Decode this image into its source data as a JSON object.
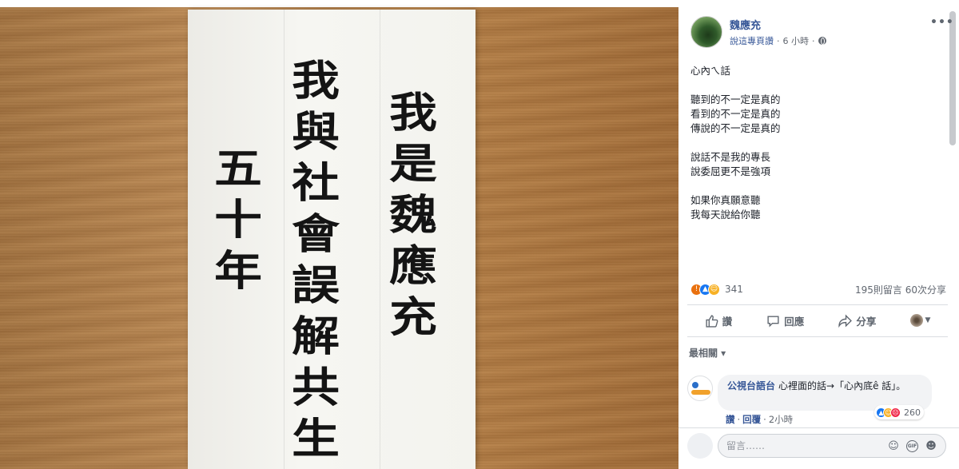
{
  "photo": {
    "calligraphy": {
      "right_column": [
        "我",
        "是",
        "魏",
        "應",
        "充"
      ],
      "middle_column": [
        "我",
        "與",
        "社",
        "會",
        "誤",
        "解",
        "共",
        "生"
      ],
      "left_column": [
        "五",
        "十",
        "年"
      ]
    }
  },
  "post": {
    "author": "魏應充",
    "page_name": "說這專頁讚",
    "time": "6 小時",
    "dot_sep": "·",
    "more_label": "•••",
    "body": [
      [
        "心內ㄟ話"
      ],
      [
        "聽到的不一定是真的",
        "看到的不一定是真的",
        "傳說的不一定是真的"
      ],
      [
        "說話不是我的專長",
        "說委屈更不是強項"
      ],
      [
        "如果你真願意聽",
        "我每天說給你聽"
      ]
    ],
    "reaction_count": "341",
    "comment_share": "195則留言 60次分享"
  },
  "actions": {
    "like": "讚",
    "comment": "回應",
    "share": "分享"
  },
  "comments": {
    "sort_label": "最相關 ▾",
    "items": [
      {
        "author": "公視台語台",
        "text": "心裡面的話→「心內底ê 話」。",
        "reaction_count": "260",
        "like_link": "讚",
        "reply_link": "回覆",
        "time": "2小時"
      }
    ]
  },
  "composer": {
    "placeholder": "留言……"
  },
  "colors": {
    "link_blue": "#385898",
    "text": "#1d2129",
    "muted": "#616770",
    "like_blue": "#1877f2",
    "wood": "#b98247"
  }
}
